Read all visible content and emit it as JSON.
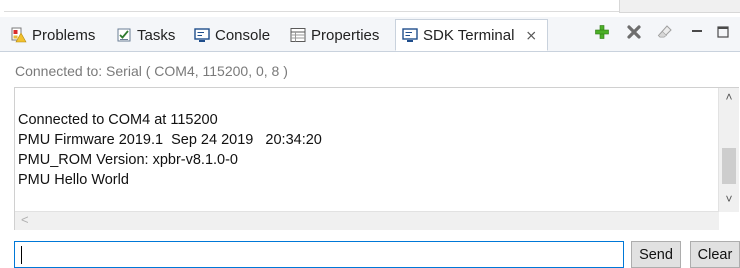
{
  "tabs": [
    {
      "label": "Problems",
      "icon": "problems-icon"
    },
    {
      "label": "Tasks",
      "icon": "tasks-icon"
    },
    {
      "label": "Console",
      "icon": "console-icon"
    },
    {
      "label": "Properties",
      "icon": "properties-icon"
    },
    {
      "label": "SDK Terminal",
      "icon": "sdk-terminal-icon",
      "active": true,
      "closable": true
    }
  ],
  "toolbar": [
    "add-icon",
    "remove-icon",
    "clear-eraser-icon",
    "minimize-icon",
    "maximize-icon"
  ],
  "status": "Connected to: Serial ( COM4, 115200, 0, 8 )",
  "terminal": {
    "output": "Connected to COM4 at 115200\nPMU Firmware 2019.1  Sep 24 2019   20:34:20\nPMU_ROM Version: xpbr-v8.1.0-0\nPMU Hello World"
  },
  "input": {
    "value": "",
    "placeholder": ""
  },
  "buttons": {
    "send": "Send",
    "clear": "Clear"
  },
  "colors": {
    "accent": "#0078d7",
    "tab_bar": "#f4f6f9"
  }
}
